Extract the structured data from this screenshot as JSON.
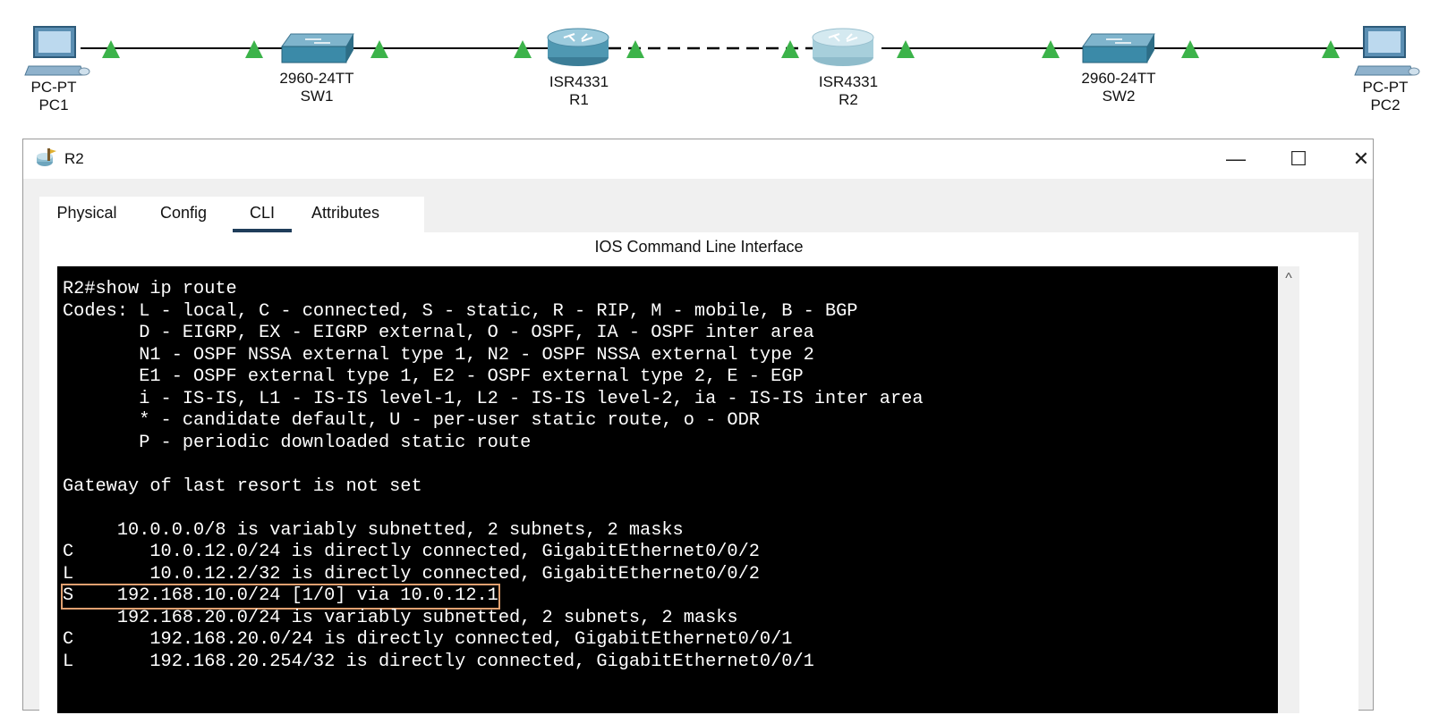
{
  "topology": {
    "devices": [
      {
        "id": "pc1",
        "model": "PC-PT",
        "name": "PC1"
      },
      {
        "id": "sw1",
        "model": "2960-24TT",
        "name": "SW1"
      },
      {
        "id": "r1",
        "model": "ISR4331",
        "name": "R1"
      },
      {
        "id": "r2",
        "model": "ISR4331",
        "name": "R2"
      },
      {
        "id": "sw2",
        "model": "2960-24TT",
        "name": "SW2"
      },
      {
        "id": "pc2",
        "model": "PC-PT",
        "name": "PC2"
      }
    ],
    "link_status_color": "#3cb34a",
    "serial_link_style": "dashed"
  },
  "window": {
    "title": "R2",
    "buttons": {
      "minimize": "—",
      "maximize": "☐",
      "close": "✕"
    },
    "tabs": [
      "Physical",
      "Config",
      "CLI",
      "Attributes"
    ],
    "active_tab": "CLI",
    "panel_title": "IOS Command Line Interface"
  },
  "terminal": {
    "lines": [
      "R2#show ip route",
      "Codes: L - local, C - connected, S - static, R - RIP, M - mobile, B - BGP",
      "       D - EIGRP, EX - EIGRP external, O - OSPF, IA - OSPF inter area",
      "       N1 - OSPF NSSA external type 1, N2 - OSPF NSSA external type 2",
      "       E1 - OSPF external type 1, E2 - OSPF external type 2, E - EGP",
      "       i - IS-IS, L1 - IS-IS level-1, L2 - IS-IS level-2, ia - IS-IS inter area",
      "       * - candidate default, U - per-user static route, o - ODR",
      "       P - periodic downloaded static route",
      "",
      "Gateway of last resort is not set",
      "",
      "     10.0.0.0/8 is variably subnetted, 2 subnets, 2 masks",
      "C       10.0.12.0/24 is directly connected, GigabitEthernet0/0/2",
      "L       10.0.12.2/32 is directly connected, GigabitEthernet0/0/2",
      "S    192.168.10.0/24 [1/0] via 10.0.12.1",
      "     192.168.20.0/24 is variably subnetted, 2 subnets, 2 masks",
      "C       192.168.20.0/24 is directly connected, GigabitEthernet0/0/1",
      "L       192.168.20.254/32 is directly connected, GigabitEthernet0/0/1"
    ],
    "highlighted_line_index": 14,
    "highlight_color": "#e0a070",
    "background": "#000000",
    "foreground": "#ffffff"
  }
}
